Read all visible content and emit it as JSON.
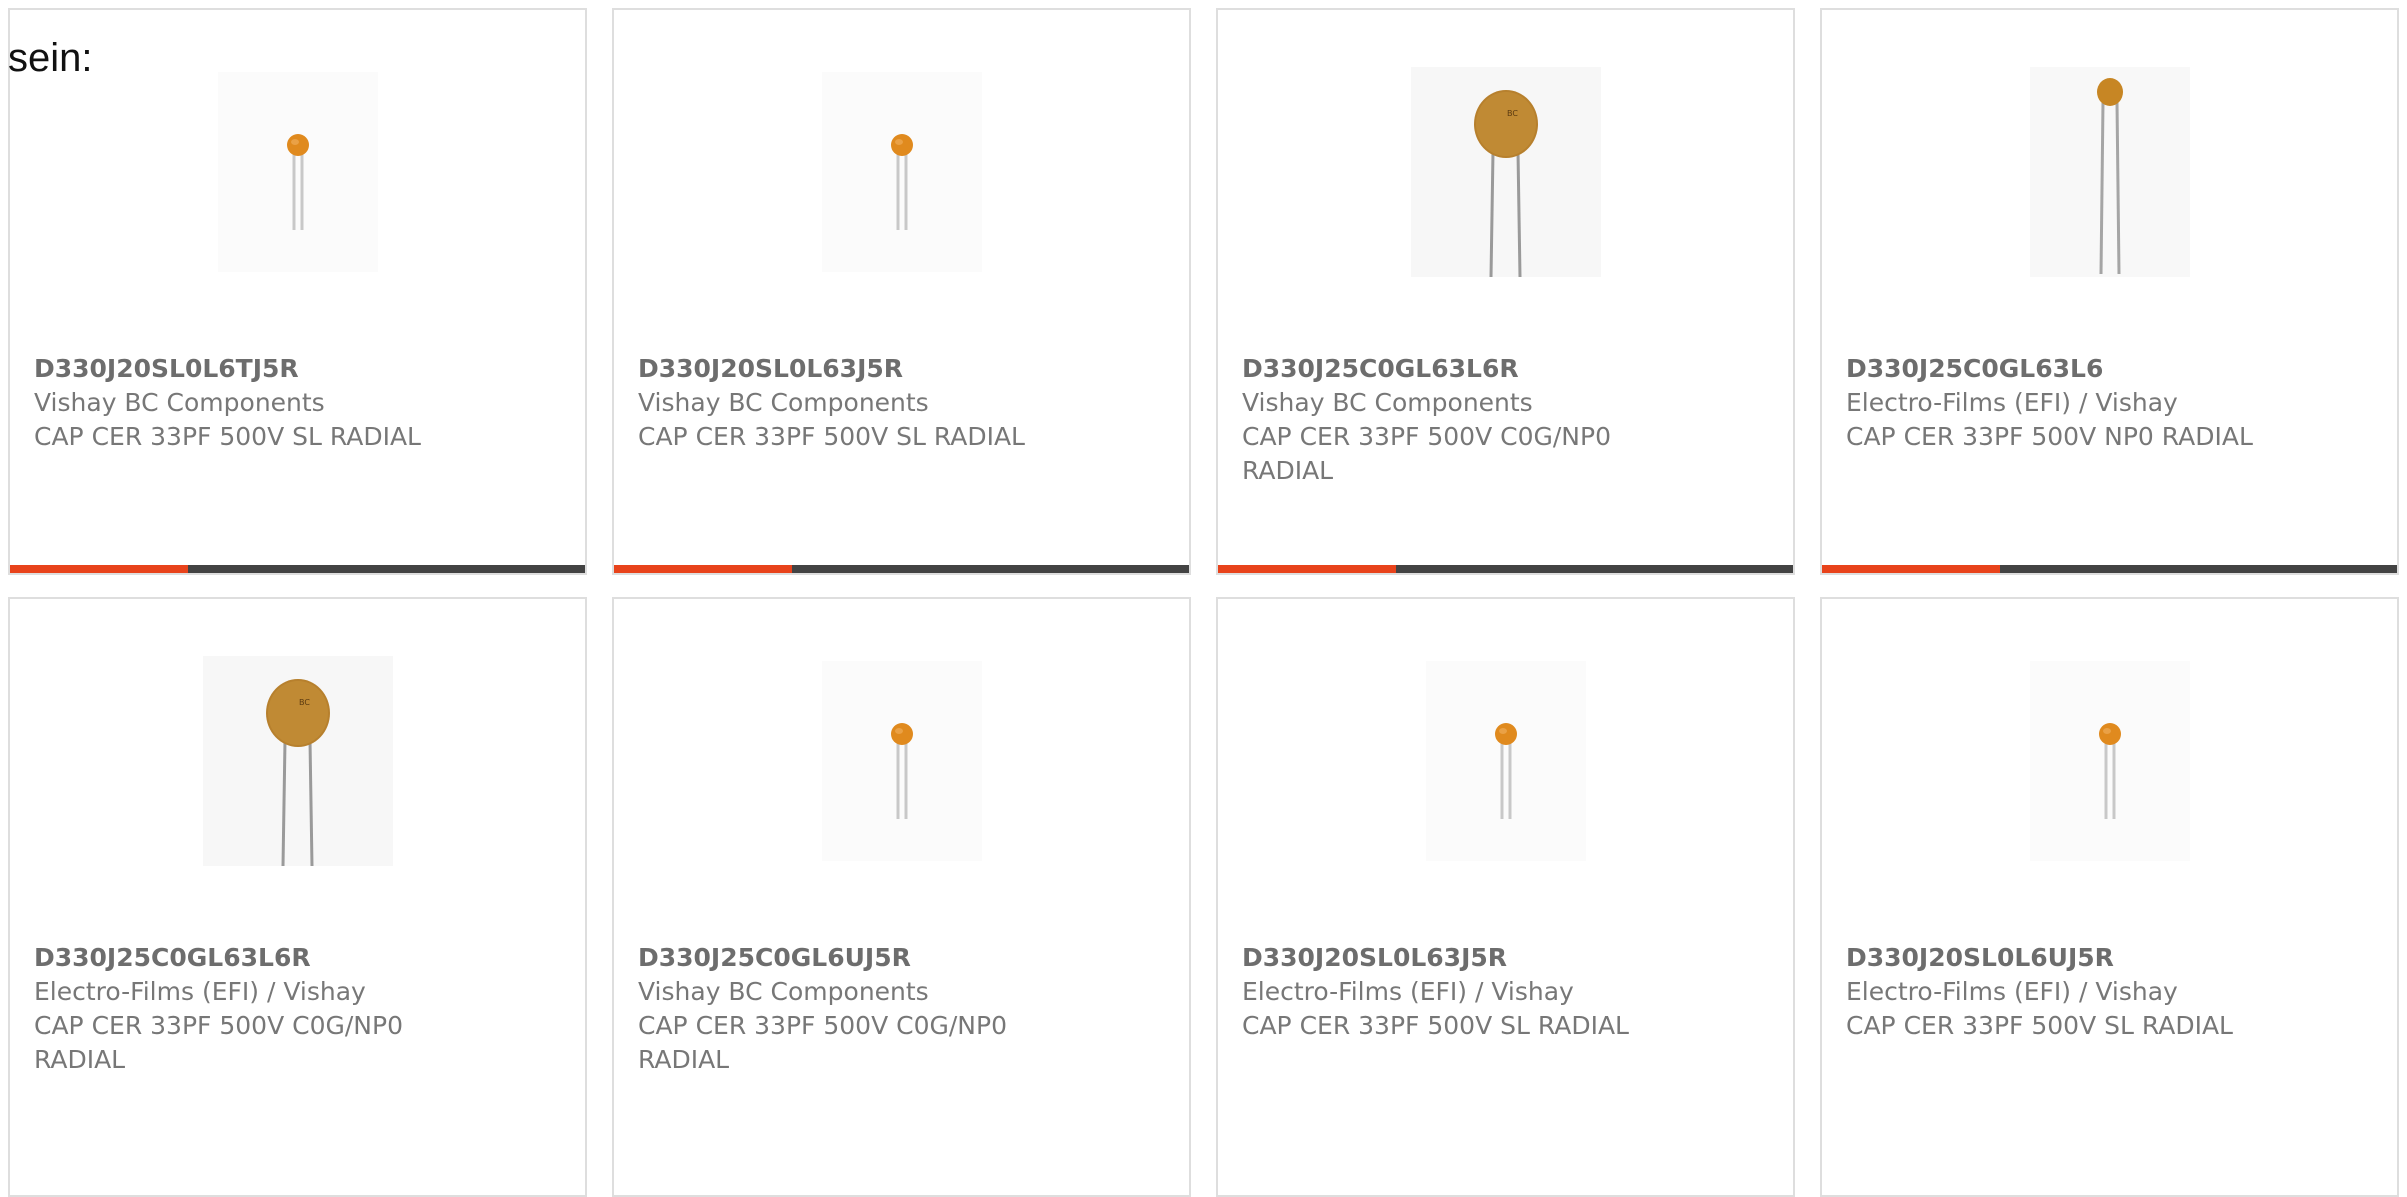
{
  "intro_text": "sein:",
  "colors": {
    "accent": "#e8431b",
    "track": "#434343",
    "border": "#dedede",
    "text": "#777777"
  },
  "progress_fraction": 0.31,
  "products": [
    {
      "part_number": "D330J20SL0L6TJ5R",
      "manufacturer": "Vishay BC Components",
      "description": "CAP CER 33PF 500V SL RADIAL",
      "image": "small-disc-capacitor"
    },
    {
      "part_number": "D330J20SL0L63J5R",
      "manufacturer": "Vishay BC Components",
      "description": "CAP CER 33PF 500V SL RADIAL",
      "image": "small-disc-capacitor"
    },
    {
      "part_number": "D330J25C0GL63L6R",
      "manufacturer": "Vishay BC Components",
      "description": "CAP CER 33PF 500V C0G/NP0 RADIAL",
      "image": "large-disc-capacitor"
    },
    {
      "part_number": "D330J25C0GL63L6",
      "manufacturer": "Electro-Films (EFI) / Vishay",
      "description": "CAP CER 33PF 500V NP0 RADIAL",
      "image": "long-lead-capacitor"
    },
    {
      "part_number": "D330J25C0GL63L6R",
      "manufacturer": "Electro-Films (EFI) / Vishay",
      "description": "CAP CER 33PF 500V C0G/NP0 RADIAL",
      "image": "large-disc-capacitor"
    },
    {
      "part_number": "D330J25C0GL6UJ5R",
      "manufacturer": "Vishay BC Components",
      "description": "CAP CER 33PF 500V C0G/NP0 RADIAL",
      "image": "small-disc-capacitor"
    },
    {
      "part_number": "D330J20SL0L63J5R",
      "manufacturer": "Electro-Films (EFI) / Vishay",
      "description": "CAP CER 33PF 500V SL RADIAL",
      "image": "small-disc-capacitor"
    },
    {
      "part_number": "D330J20SL0L6UJ5R",
      "manufacturer": "Electro-Films (EFI) / Vishay",
      "description": "CAP CER 33PF 500V SL RADIAL",
      "image": "small-disc-capacitor"
    }
  ]
}
